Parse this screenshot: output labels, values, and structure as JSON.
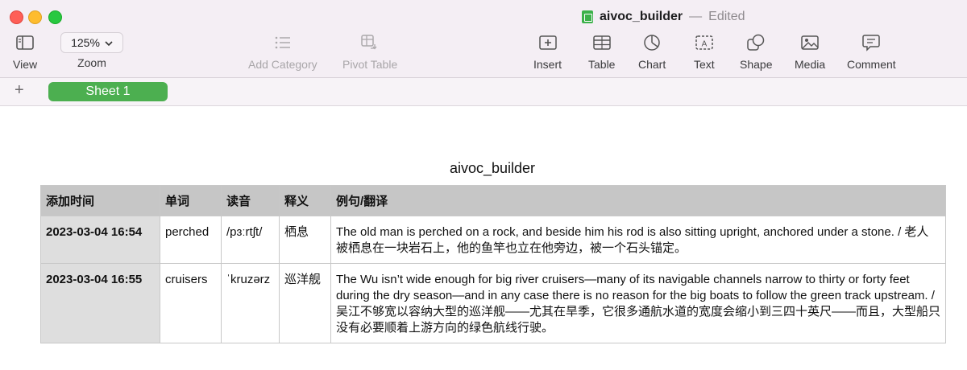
{
  "window": {
    "doc_name": "aivoc_builder",
    "doc_separator": "—",
    "doc_status": "Edited"
  },
  "toolbar": {
    "view_label": "View",
    "zoom_value": "125%",
    "zoom_label": "Zoom",
    "add_category_label": "Add Category",
    "pivot_table_label": "Pivot Table",
    "insert_label": "Insert",
    "table_label": "Table",
    "chart_label": "Chart",
    "text_label": "Text",
    "shape_label": "Shape",
    "media_label": "Media",
    "comment_label": "Comment"
  },
  "tabs": {
    "add_sheet": "+",
    "sheets": [
      {
        "label": "Sheet 1",
        "active": true
      }
    ]
  },
  "sheet": {
    "table_title": "aivoc_builder",
    "headers": [
      "添加时间",
      "单词",
      "读音",
      "释义",
      "例句/翻译"
    ],
    "rows": [
      {
        "time": "2023-03-04 16:54",
        "word": "perched",
        "phonetic": "/pɜːrtʃt/",
        "meaning": "栖息",
        "example": "The old man is perched on a rock, and beside him his rod is also sitting upright, anchored under a stone. / 老人被栖息在一块岩石上，他的鱼竿也立在他旁边，被一个石头锚定。"
      },
      {
        "time": "2023-03-04 16:55",
        "word": "cruisers",
        "phonetic": "ˈkruzərz",
        "meaning": "巡洋舰",
        "example": "The Wu isn’t wide enough for big river cruisers—many of its navigable channels narrow to thirty or forty feet during the dry season—and in any case there is no reason for the big boats to follow the green track upstream. / 吴江不够宽以容纳大型的巡洋舰——尤其在旱季，它很多通航水道的宽度会缩小到三四十英尺——而且，大型船只没有必要顺着上游方向的绿色航线行驶。"
      }
    ]
  },
  "colors": {
    "titlebar_bg": "#f4eef4",
    "sheet_tab_active": "#4caf50",
    "header_row_bg": "#c6c6c6",
    "timestamp_col_bg": "#dedede"
  },
  "icons": [
    "sidebar-view-icon",
    "chevron-down-icon",
    "add-category-icon",
    "pivot-table-icon",
    "insert-icon",
    "table-icon",
    "chart-icon",
    "text-icon",
    "shape-icon",
    "media-icon",
    "comment-icon",
    "numbers-doc-icon"
  ]
}
